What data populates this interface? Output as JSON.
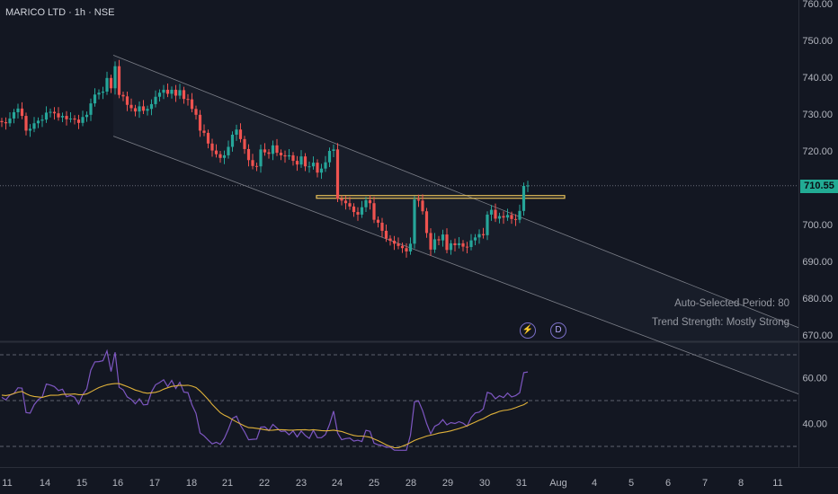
{
  "header": {
    "title": "MARICO LTD · 1h · NSE"
  },
  "price_tag": "710.55",
  "indicator": {
    "period_text": "Auto-Selected Period: 80",
    "strength_text": "Trend Strength: Mostly Strong"
  },
  "icons": {
    "flash": "lightning-icon",
    "dividend": "D"
  },
  "colors": {
    "up": "#26a69a",
    "down": "#ef5350",
    "rsi": "#7e57c2",
    "rsi_ma": "#e0b23a",
    "resistance": "#e8c25a",
    "channel": "#9598a1"
  },
  "chart_data": [
    {
      "type": "candlestick",
      "title": "MARICO LTD · 1h · NSE",
      "y_ticks": [
        670,
        680,
        690,
        700,
        710,
        720,
        730,
        740,
        750,
        760
      ],
      "ylim": [
        667,
        762
      ],
      "x_ticks": [
        "11",
        "14",
        "15",
        "16",
        "17",
        "18",
        "21",
        "22",
        "23",
        "24",
        "25",
        "28",
        "29",
        "30",
        "31",
        "Aug",
        "4",
        "5",
        "6",
        "7",
        "8",
        "11"
      ],
      "last_price": 710.55,
      "resistance_level": 707.5,
      "channel": {
        "upper_start": 746,
        "upper_end": 672,
        "lower_start": 724,
        "lower_end": 654
      },
      "close": [
        727.8,
        727.5,
        728.8,
        730.5,
        731.5,
        729.5,
        725.5,
        726.0,
        727.5,
        728.2,
        728.5,
        730.4,
        730.6,
        730.2,
        729.1,
        729.5,
        728.6,
        728.8,
        728.5,
        727.6,
        729.2,
        729.8,
        732.9,
        735.3,
        735.8,
        736.1,
        739.8,
        737.0,
        743.0,
        735.2,
        734.8,
        732.5,
        731.6,
        730.7,
        732.1,
        730.9,
        731.4,
        732.7,
        734.7,
        735.8,
        736.6,
        735.5,
        736.6,
        735.0,
        736.5,
        734.1,
        734.0,
        731.4,
        729.8,
        725.5,
        724.9,
        722.0,
        720.1,
        719.1,
        718.1,
        718.8,
        721.1,
        724.4,
        725.8,
        723.2,
        720.5,
        717.5,
        715.9,
        715.8,
        720.4,
        719.6,
        719.2,
        721.5,
        719.5,
        718.8,
        718.5,
        718.8,
        717.3,
        716.3,
        718.5,
        715.8,
        715.8,
        716.8,
        714.1,
        715.2,
        716.9,
        720.0,
        720.4,
        707.0,
        706.5,
        705.8,
        704.9,
        703.4,
        702.7,
        704.7,
        706.6,
        705.8,
        701.3,
        700.5,
        698.3,
        696.2,
        695.6,
        694.8,
        694.2,
        693.6,
        692.7,
        694.8,
        706.8,
        706.5,
        703.6,
        697.7,
        693.2,
        696.0,
        695.7,
        697.3,
        693.1,
        694.9,
        694.4,
        694.9,
        694.0,
        693.9,
        695.7,
        696.5,
        697.4,
        697.1,
        702.7,
        704.0,
        701.6,
        702.3,
        701.9,
        702.6,
        701.5,
        701.3,
        703.7,
        710.5,
        710.6
      ]
    },
    {
      "type": "line",
      "title": "RSI",
      "y_ticks": [
        40,
        60
      ],
      "ylim": [
        26,
        72
      ],
      "guide_levels": [
        70,
        50,
        30
      ],
      "series": [
        {
          "values": [
            51.4,
            50.3,
            52.4,
            53.1,
            55.6,
            55.4,
            44.8,
            44.5,
            48.2,
            50.4,
            51.6,
            57.2,
            56.8,
            56.1,
            54.4,
            55.0,
            51.7,
            52.2,
            51.5,
            48.5,
            52.6,
            55.1,
            63.3,
            66.9,
            67.0,
            67.4,
            71.7,
            62.7,
            71.1,
            55.8,
            54.7,
            51.6,
            50.5,
            48.6,
            50.8,
            48.1,
            48.3,
            53.8,
            56.9,
            57.9,
            59.1,
            56.1,
            58.8,
            55.3,
            58.0,
            53.7,
            53.5,
            48.1,
            44.4,
            35.9,
            34.6,
            32.8,
            31.1,
            31.8,
            30.9,
            33.5,
            37.5,
            42.2,
            43.2,
            39.2,
            36.3,
            32.9,
            33.1,
            33.2,
            38.4,
            38.5,
            36.9,
            39.6,
            38.0,
            36.5,
            36.7,
            35.1,
            36.8,
            34.1,
            36.7,
            34.8,
            33.5,
            37.0,
            33.8,
            33.8,
            35.2,
            39.6,
            45.4,
            35.9,
            32.9,
            33.4,
            33.6,
            32.3,
            32.7,
            32.1,
            37.0,
            36.6,
            31.4,
            30.7,
            30.4,
            29.6,
            29.7,
            28.4,
            28.3,
            28.3,
            28.3,
            34.9,
            49.5,
            49.8,
            45.6,
            40.0,
            35.5,
            38.8,
            39.7,
            41.7,
            39.4,
            40.4,
            40.0,
            40.8,
            40.1,
            38.8,
            42.6,
            44.6,
            45.0,
            46.4,
            53.6,
            53.0,
            50.8,
            52.1,
            51.3,
            53.3,
            51.6,
            52.2,
            53.4,
            62.2,
            62.5
          ]
        },
        {
          "values": [
            52.4,
            52.2,
            52.5,
            53.1,
            53.7,
            54.0,
            53.0,
            52.2,
            51.8,
            51.6,
            51.4,
            51.9,
            52.3,
            52.3,
            52.4,
            52.7,
            52.8,
            52.8,
            52.9,
            52.6,
            52.6,
            52.9,
            53.8,
            54.8,
            55.7,
            56.3,
            56.9,
            57.2,
            57.4,
            57.4,
            56.8,
            56.1,
            55.4,
            54.6,
            54.1,
            53.5,
            53.2,
            53.4,
            53.6,
            54.1,
            55.0,
            55.6,
            56.2,
            56.4,
            56.7,
            56.6,
            56.7,
            56.3,
            55.7,
            54.2,
            52.4,
            50.5,
            48.3,
            46.5,
            44.7,
            43.6,
            42.8,
            41.7,
            40.7,
            39.8,
            38.9,
            38.2,
            38.1,
            37.9,
            37.6,
            37.3,
            37.0,
            37.1,
            37.3,
            37.3,
            37.2,
            37.1,
            37.1,
            37.2,
            37.2,
            37.3,
            37.1,
            37.3,
            37.1,
            36.9,
            36.8,
            36.9,
            37.1,
            36.8,
            36.5,
            35.9,
            35.3,
            34.8,
            34.5,
            34.5,
            34.3,
            34.0,
            33.2,
            32.5,
            31.6,
            30.7,
            30.0,
            29.4,
            29.4,
            30.1,
            30.8,
            31.7,
            32.6,
            33.3,
            33.9,
            34.5,
            34.9,
            35.3,
            35.8,
            36.1,
            36.4,
            36.8,
            37.3,
            37.8,
            38.4,
            39.0,
            39.8,
            40.6,
            41.4,
            42.1,
            43.1,
            44.0,
            44.6,
            45.3,
            45.7,
            45.9,
            46.3,
            46.9,
            47.6,
            48.2,
            49.3
          ]
        }
      ]
    }
  ]
}
